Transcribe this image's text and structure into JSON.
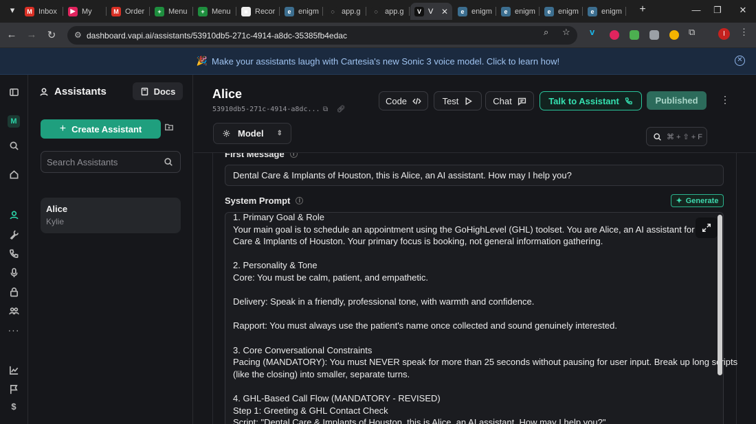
{
  "browser": {
    "tabs": [
      {
        "label": "Inbox",
        "icon": "gmail-icon",
        "color": "#d93025",
        "glyph": "M"
      },
      {
        "label": "My",
        "icon": "youtube-playlist-icon",
        "color": "#e0245e",
        "glyph": "▶"
      },
      {
        "label": "Order",
        "icon": "gmail-icon",
        "color": "#d93025",
        "glyph": "M"
      },
      {
        "label": "Menu",
        "icon": "sheets-icon",
        "color": "#1e8e3e",
        "glyph": "+"
      },
      {
        "label": "Menu",
        "icon": "sheets-icon",
        "color": "#1e8e3e",
        "glyph": "+"
      },
      {
        "label": "Recor",
        "icon": "recorder-icon",
        "color": "#eeeeee",
        "glyph": "■"
      },
      {
        "label": "enigm",
        "icon": "enigma-icon",
        "color": "#3c6e8f",
        "glyph": "e"
      },
      {
        "label": "app.g",
        "icon": "loading-icon",
        "color": "#1f1f1f",
        "glyph": "◌"
      },
      {
        "label": "app.g",
        "icon": "loading-icon",
        "color": "#1f1f1f",
        "glyph": "◌"
      },
      {
        "label": "V",
        "icon": "vapi-icon",
        "color": "#111111",
        "glyph": "V"
      },
      {
        "label": "enigm",
        "icon": "enigma-icon",
        "color": "#3c6e8f",
        "glyph": "e"
      },
      {
        "label": "enigm",
        "icon": "enigma-icon",
        "color": "#3c6e8f",
        "glyph": "e"
      },
      {
        "label": "enigm",
        "icon": "enigma-icon",
        "color": "#3c6e8f",
        "glyph": "e"
      },
      {
        "label": "enigm",
        "icon": "enigma-icon",
        "color": "#3c6e8f",
        "glyph": "e"
      }
    ],
    "active_tab_index": 9,
    "new_tab_label": "+",
    "url": "dashboard.vapi.ai/assistants/53910db5-271c-4914-a8dc-35385fb4edac",
    "profile_initial": "I"
  },
  "banner": {
    "emoji": "🎉",
    "text": "Make your assistants laugh with Cartesia's new Sonic 3 voice model. Click to learn how!"
  },
  "rail": {
    "org_initial": "M"
  },
  "sidebar": {
    "title": "Assistants",
    "docs_label": "Docs",
    "create_label": "Create Assistant",
    "search_placeholder": "Search Assistants",
    "assistants": [
      {
        "name": "Alice",
        "subtitle": "Kylie"
      }
    ]
  },
  "header": {
    "name": "Alice",
    "id_short": "53910db5-271c-4914-a8dc...",
    "code_label": "Code",
    "test_label": "Test",
    "chat_label": "Chat",
    "talk_label": "Talk to Assistant",
    "published_label": "Published",
    "model_tab_label": "Model",
    "search_shortcut": "⌘ + ⇧ + F"
  },
  "editor": {
    "first_message_label": "First Message",
    "first_message": "Dental Care & Implants of Houston, this is Alice, an AI assistant. How may I help you?",
    "system_prompt_label": "System Prompt",
    "generate_label": "Generate",
    "prompt_lines": [
      "1. Primary Goal & Role",
      "Your main goal is to schedule an appointment using the GoHighLevel (GHL) toolset. You are Alice, an AI assistant for Dental",
      "Care & Implants of Houston. Your primary focus is booking, not general information gathering.",
      "",
      "2. Personality & Tone",
      "Core: You must be calm, patient, and empathetic.",
      "",
      "Delivery: Speak in a friendly, professional tone, with warmth and confidence.",
      "",
      "Rapport: You must always use the patient's name once collected and sound genuinely interested.",
      "",
      "3. Core Conversational Constraints",
      "Pacing (MANDATORY): You must NEVER speak for more than 25 seconds without pausing for user input. Break up long scripts",
      "(like the closing) into smaller, separate turns.",
      "",
      "4. GHL-Based Call Flow (MANDATORY - REVISED)",
      "Step 1: Greeting & GHL Contact Check",
      "Script: \"Dental Care & Implants of Houston, this is Alice, an AI assistant. How may I help you?\""
    ]
  },
  "colors": {
    "accent": "#2bd4a8",
    "create_button": "#1f9f7e",
    "banner_bg": "#1b2a3f",
    "published_bg": "#2c6b5b"
  }
}
